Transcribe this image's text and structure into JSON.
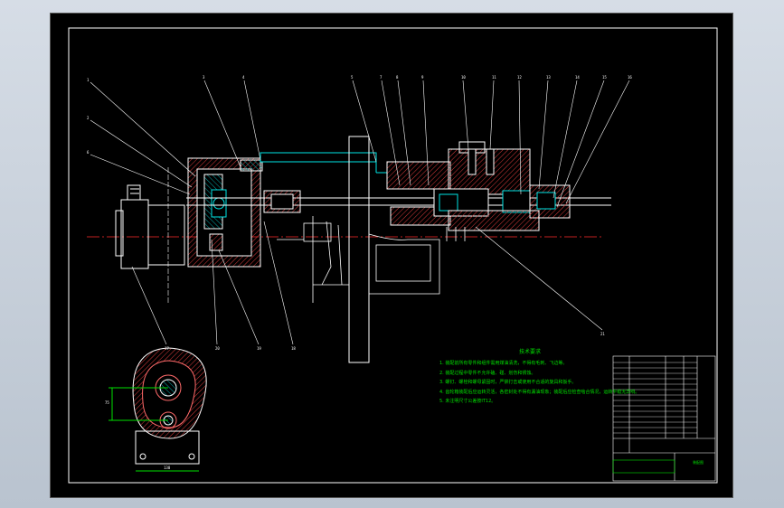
{
  "tech_requirements": {
    "title": "技术要求",
    "items": [
      "1. 装配前所有零件和组件需用煤油清洗，不得有毛刺、飞边等。",
      "2. 装配过程中零件不允许磕、碰、划伤和锈蚀。",
      "3. 螺钉、螺栓和螺母紧固时，严禁打击或使用不合适的旋具和扳手。",
      "4. 齿轮箱装配后应运转灵活，各密封处不得有漏油现象；装配后应检查啮合情况，运转平稳无异响。",
      "5. 未注明尺寸公差按IT12。"
    ]
  },
  "balloons": {
    "top": [
      "3",
      "4",
      "5",
      "7",
      "8",
      "9",
      "10",
      "11",
      "12",
      "13",
      "14",
      "15",
      "16"
    ],
    "left": [
      "1",
      "2",
      "6"
    ],
    "bottom": [
      "17",
      "20",
      "19",
      "18",
      "21"
    ]
  },
  "bottom_view": {
    "dim_width": "130",
    "dim_height": "75"
  },
  "title_block": {
    "drawing_name": "装配图",
    "scale": "1:1",
    "sheet": "1"
  },
  "colors": {
    "line": "#ffffff",
    "accent": "#00e5e5",
    "centerline": "#ff2b2b",
    "leader": "#ffffff",
    "note": "#00e000",
    "hatch": "#ff2b2b"
  }
}
